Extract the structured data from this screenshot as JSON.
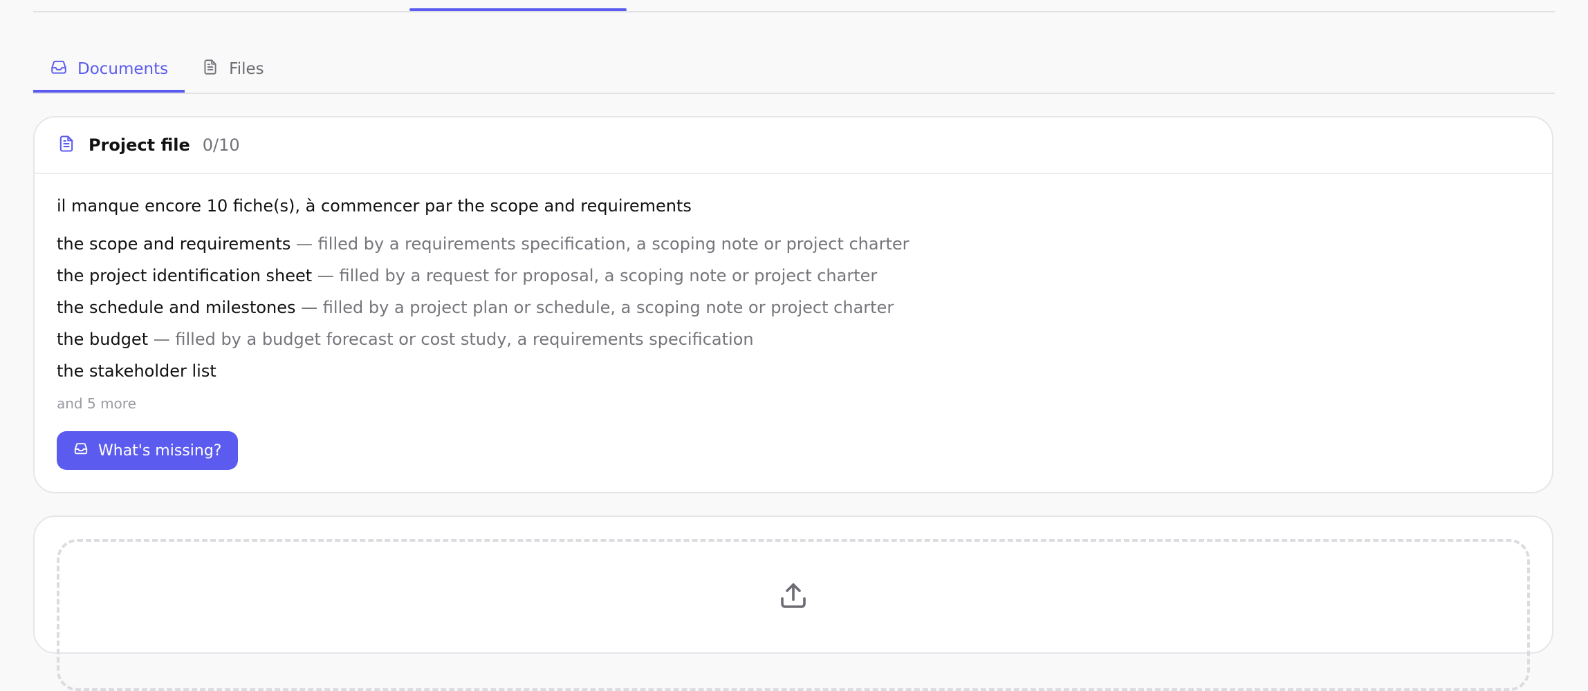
{
  "colors": {
    "accent": "#5b5bf0",
    "muted": "#75757c",
    "border": "#e6e6ea"
  },
  "tabs": [
    {
      "label": "Documents",
      "icon": "inbox-icon",
      "active": true
    },
    {
      "label": "Files",
      "icon": "file-icon",
      "active": false
    }
  ],
  "project_card": {
    "icon": "file-text-icon",
    "title": "Project file",
    "count": "0/10",
    "summary": "il manque encore 10 fiche(s), à commencer par the scope and requirements",
    "items": [
      {
        "name": "the scope and requirements",
        "desc": " — filled by a requirements specification, a scoping note or project charter"
      },
      {
        "name": "the project identification sheet",
        "desc": " — filled by a request for proposal, a scoping note or project charter"
      },
      {
        "name": "the schedule and milestones",
        "desc": " — filled by a project plan or schedule, a scoping note or project charter"
      },
      {
        "name": "the budget",
        "desc": " — filled by a budget forecast or cost study, a requirements specification"
      },
      {
        "name": "the stakeholder list",
        "desc": ""
      }
    ],
    "more": "and 5 more",
    "button": {
      "label": "What's missing?",
      "icon": "inbox-icon"
    }
  },
  "upload": {
    "icon": "upload-icon"
  }
}
